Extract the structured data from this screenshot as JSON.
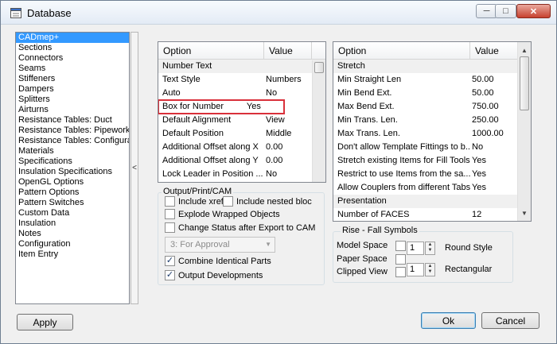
{
  "window": {
    "title": "Database"
  },
  "controls": {
    "minimize": "─",
    "maximize": "□",
    "close": "✕"
  },
  "sidebar": {
    "items": [
      "CADmep+",
      "Sections",
      "Connectors",
      "Seams",
      "Stiffeners",
      "Dampers",
      "Splitters",
      "Airturns",
      "Resistance Tables: Duct",
      "Resistance Tables: Pipework",
      "Resistance Tables: Configura",
      "Materials",
      "Specifications",
      "Insulation Specifications",
      "OpenGL Options",
      "Pattern Options",
      "Pattern Switches",
      "Custom Data",
      "Insulation",
      "Notes",
      "Configuration",
      "Item Entry"
    ],
    "selected": "CADmep+"
  },
  "splitter": {
    "glyph": "<"
  },
  "left_grid": {
    "headers": [
      "Option",
      "Value"
    ],
    "rows": [
      {
        "option": "Number Text",
        "value": "",
        "group": true
      },
      {
        "option": "Text Style",
        "value": "Numbers"
      },
      {
        "option": "Auto",
        "value": "No"
      },
      {
        "option": "Box for Number",
        "value": "Yes"
      },
      {
        "option": "Default Alignment",
        "value": "View"
      },
      {
        "option": "Default Position",
        "value": "Middle"
      },
      {
        "option": "Additional Offset along X",
        "value": "0.00"
      },
      {
        "option": "Additional Offset along Y",
        "value": "0.00"
      },
      {
        "option": "Lock Leader in Position ...",
        "value": "No"
      }
    ]
  },
  "right_grid": {
    "headers": [
      "Option",
      "Value"
    ],
    "rows": [
      {
        "option": "Stretch",
        "value": "",
        "group": true
      },
      {
        "option": "Min Straight Len",
        "value": "50.00"
      },
      {
        "option": "Min Bend Ext.",
        "value": "50.00"
      },
      {
        "option": "Max Bend Ext.",
        "value": "750.00"
      },
      {
        "option": "Min Trans. Len.",
        "value": "250.00"
      },
      {
        "option": "Max Trans. Len.",
        "value": "1000.00"
      },
      {
        "option": "Don't allow Template Fittings to b...",
        "value": "No"
      },
      {
        "option": "Stretch existing Items for Fill Tools",
        "value": "Yes"
      },
      {
        "option": "Restrict to use Items from the sa...",
        "value": "Yes"
      },
      {
        "option": "Allow Couplers from different Tabs",
        "value": "Yes"
      },
      {
        "option": "Presentation",
        "value": "",
        "group": true
      },
      {
        "option": "Number of FACES",
        "value": "12"
      }
    ]
  },
  "output_group": {
    "label": "Output/Print/CAM",
    "include_xref": {
      "label": "Include xref",
      "checked": false
    },
    "include_nested": {
      "label": "Include nested bloc",
      "checked": false
    },
    "explode_wrapped": {
      "label": "Explode Wrapped Objects",
      "checked": false
    },
    "change_status": {
      "label": "Change Status after Export to CAM",
      "checked": false
    },
    "status_combo": {
      "value": "3: For Approval",
      "enabled": false
    },
    "combine_parts": {
      "label": "Combine Identical Parts",
      "checked": true
    },
    "output_developments": {
      "label": "Output Developments",
      "checked": true
    }
  },
  "rise_fall_group": {
    "label": "Rise - Fall Symbols",
    "model_space": {
      "label": "Model Space",
      "checked": false
    },
    "paper_space": {
      "label": "Paper Space",
      "checked": false
    },
    "clipped_view": {
      "label": "Clipped View",
      "checked": false
    },
    "round_style": {
      "value": "1",
      "label": "Round Style"
    },
    "rectangular": {
      "value": "1",
      "label": "Rectangular"
    }
  },
  "buttons": {
    "apply": "Apply",
    "ok": "Ok",
    "cancel": "Cancel"
  },
  "check_glyph": "✓"
}
